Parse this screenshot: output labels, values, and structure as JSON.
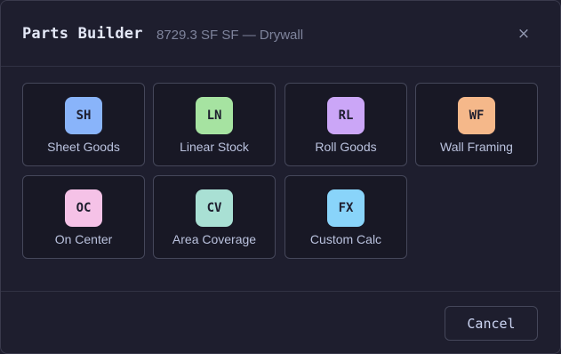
{
  "dialog": {
    "title": "Parts Builder",
    "subtitle": "8729.3 SF SF — Drywall",
    "close_label": "×"
  },
  "cards": [
    {
      "code": "SH",
      "label": "Sheet Goods",
      "color": "#89b4fa"
    },
    {
      "code": "LN",
      "label": "Linear Stock",
      "color": "#a6e3a1"
    },
    {
      "code": "RL",
      "label": "Roll Goods",
      "color": "#cba6f7"
    },
    {
      "code": "WF",
      "label": "Wall Framing",
      "color": "#f5b88a"
    },
    {
      "code": "OC",
      "label": "On Center",
      "color": "#f5c2e7"
    },
    {
      "code": "CV",
      "label": "Area Coverage",
      "color": "#a9e0d4"
    },
    {
      "code": "FX",
      "label": "Custom Calc",
      "color": "#89d4fa"
    }
  ],
  "footer": {
    "cancel_label": "Cancel"
  }
}
